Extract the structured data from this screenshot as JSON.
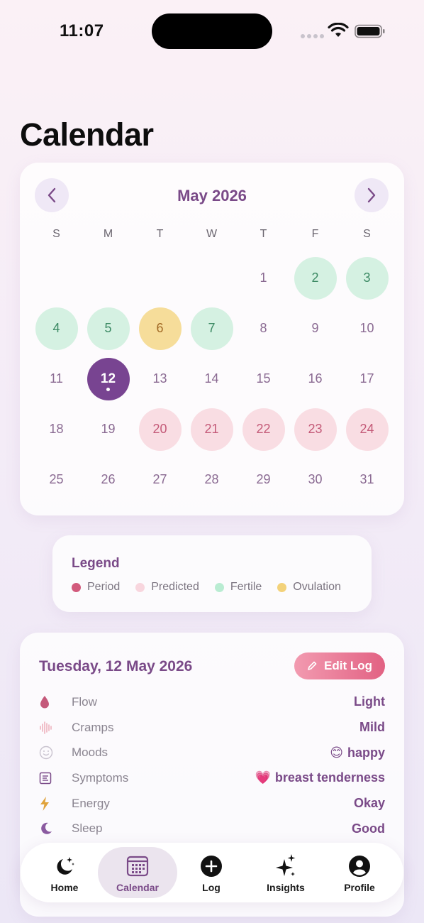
{
  "status_bar": {
    "time": "11:07"
  },
  "page_title": "Calendar",
  "calendar": {
    "month_label": "May 2026",
    "weekdays": [
      "S",
      "M",
      "T",
      "W",
      "T",
      "F",
      "S"
    ],
    "days": [
      {
        "label": "",
        "state": "empty"
      },
      {
        "label": "",
        "state": "empty"
      },
      {
        "label": "",
        "state": "empty"
      },
      {
        "label": "",
        "state": "empty"
      },
      {
        "label": "1",
        "state": "normal"
      },
      {
        "label": "2",
        "state": "fertile"
      },
      {
        "label": "3",
        "state": "fertile"
      },
      {
        "label": "4",
        "state": "fertile"
      },
      {
        "label": "5",
        "state": "fertile"
      },
      {
        "label": "6",
        "state": "ovulation"
      },
      {
        "label": "7",
        "state": "fertile"
      },
      {
        "label": "8",
        "state": "normal"
      },
      {
        "label": "9",
        "state": "normal"
      },
      {
        "label": "10",
        "state": "normal"
      },
      {
        "label": "11",
        "state": "normal"
      },
      {
        "label": "12",
        "state": "today"
      },
      {
        "label": "13",
        "state": "normal"
      },
      {
        "label": "14",
        "state": "normal"
      },
      {
        "label": "15",
        "state": "normal"
      },
      {
        "label": "16",
        "state": "normal"
      },
      {
        "label": "17",
        "state": "normal"
      },
      {
        "label": "18",
        "state": "normal"
      },
      {
        "label": "19",
        "state": "normal"
      },
      {
        "label": "20",
        "state": "predicted"
      },
      {
        "label": "21",
        "state": "predicted"
      },
      {
        "label": "22",
        "state": "predicted"
      },
      {
        "label": "23",
        "state": "predicted"
      },
      {
        "label": "24",
        "state": "predicted"
      },
      {
        "label": "25",
        "state": "normal"
      },
      {
        "label": "26",
        "state": "normal"
      },
      {
        "label": "27",
        "state": "normal"
      },
      {
        "label": "28",
        "state": "normal"
      },
      {
        "label": "29",
        "state": "normal"
      },
      {
        "label": "30",
        "state": "normal"
      },
      {
        "label": "31",
        "state": "normal"
      }
    ]
  },
  "legend": {
    "title": "Legend",
    "items": [
      {
        "label": "Period",
        "color": "#d25a7c"
      },
      {
        "label": "Predicted",
        "color": "#f8d6de"
      },
      {
        "label": "Fertile",
        "color": "#b9ecd2"
      },
      {
        "label": "Ovulation",
        "color": "#f3d27a"
      }
    ]
  },
  "detail": {
    "date_label": "Tuesday, 12 May 2026",
    "edit_button": "Edit Log",
    "rows": [
      {
        "icon": "drop-icon",
        "label": "Flow",
        "value": "Light",
        "emoji": ""
      },
      {
        "icon": "waveform-icon",
        "label": "Cramps",
        "value": "Mild",
        "emoji": ""
      },
      {
        "icon": "smiley-icon",
        "label": "Moods",
        "value": "happy",
        "emoji": "😊"
      },
      {
        "icon": "list-icon",
        "label": "Symptoms",
        "value": "breast tenderness",
        "emoji": "💗"
      },
      {
        "icon": "bolt-icon",
        "label": "Energy",
        "value": "Okay",
        "emoji": ""
      },
      {
        "icon": "moon-icon",
        "label": "Sleep",
        "value": "Good",
        "emoji": ""
      }
    ]
  },
  "tab_bar": {
    "tabs": [
      {
        "label": "Home",
        "icon": "moon-stars-icon"
      },
      {
        "label": "Calendar",
        "icon": "calendar-icon",
        "active": true
      },
      {
        "label": "Log",
        "icon": "plus-circle-icon"
      },
      {
        "label": "Insights",
        "icon": "sparkles-icon"
      },
      {
        "label": "Profile",
        "icon": "person-circle-icon"
      }
    ]
  },
  "colors": {
    "accent": "#7a4a88",
    "today": "#784491",
    "fertile_bg": "#d5f1e2",
    "ovulation_bg": "#f6dd9a",
    "predicted_bg": "#f9dde3",
    "edit_button_start": "#f29ab0",
    "edit_button_end": "#e26283"
  }
}
